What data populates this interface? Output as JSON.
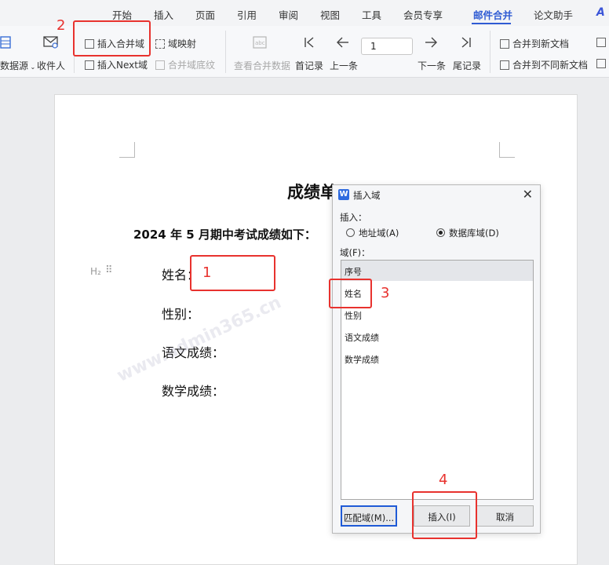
{
  "tabs": [
    "开始",
    "插入",
    "页面",
    "引用",
    "审阅",
    "视图",
    "工具",
    "会员专享",
    "邮件合并",
    "论文助手"
  ],
  "active_tab": "邮件合并",
  "ribbon": {
    "data_source": "数据源",
    "recipients": "收件人",
    "insert_merge_field": "插入合并域",
    "insert_next_field": "插入Next域",
    "field_mapping": "域映射",
    "merge_field_shading": "合并域底纹",
    "view_merged_data": "查看合并数据",
    "first_record": "首记录",
    "prev_record": "上一条",
    "record_number": "1",
    "next_record": "下一条",
    "last_record": "尾记录",
    "merge_to_new_doc": "合并到新文档",
    "merge_to_diff_docs": "合并到不同新文档"
  },
  "document": {
    "title": "成绩单",
    "subtitle": "2024 年 5 月期中考试成绩如下：",
    "fields": [
      "姓名：",
      "性别：",
      "语文成绩：",
      "数学成绩："
    ],
    "heading_marker": "H₂"
  },
  "dialog": {
    "logo": "W",
    "title": "插入域",
    "insert_label": "插入：",
    "radio_address": "地址域(A)",
    "radio_database": "数据库域(D)",
    "field_label": "域(F)：",
    "items": [
      "序号",
      "姓名",
      "性别",
      "语文成绩",
      "数学成绩"
    ],
    "match_button": "匹配域(M)...",
    "insert_button": "插入(I)",
    "cancel_button": "取消"
  },
  "annotations": [
    "1",
    "2",
    "3",
    "4"
  ],
  "colors": {
    "accent": "#2f5bd3",
    "annotation_red": "#e8322e"
  }
}
